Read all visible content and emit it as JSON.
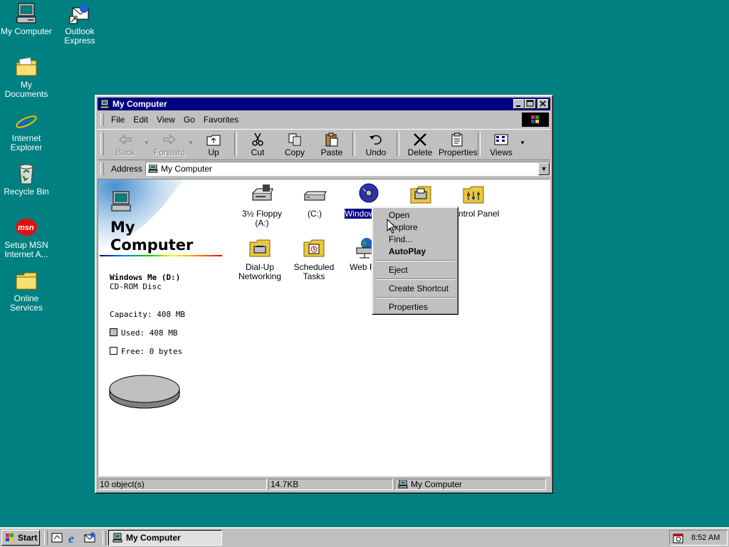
{
  "desktop": {
    "icons": [
      {
        "label": "My Computer"
      },
      {
        "label": "Outlook Express"
      },
      {
        "label": "My Documents"
      },
      {
        "label": "Internet Explorer"
      },
      {
        "label": "Recycle Bin"
      },
      {
        "label": "Setup MSN Internet A..."
      },
      {
        "label": "Online Services"
      }
    ],
    "background_color": "#008080"
  },
  "window": {
    "title": "My Computer",
    "menu": [
      "File",
      "Edit",
      "View",
      "Go",
      "Favorites"
    ],
    "toolbar": [
      {
        "label": "Back",
        "enabled": false
      },
      {
        "label": "Forward",
        "enabled": false
      },
      {
        "label": "Up",
        "enabled": true
      },
      {
        "label": "Cut",
        "enabled": true
      },
      {
        "label": "Copy",
        "enabled": true
      },
      {
        "label": "Paste",
        "enabled": true
      },
      {
        "label": "Undo",
        "enabled": true
      },
      {
        "label": "Delete",
        "enabled": true
      },
      {
        "label": "Properties",
        "enabled": true
      },
      {
        "label": "Views",
        "enabled": true
      }
    ],
    "address": {
      "label": "Address",
      "value": "My Computer"
    },
    "info": {
      "heading_line1": "My",
      "heading_line2": "Computer",
      "drive_name": "Windows Me (D:)",
      "drive_type": "CD-ROM Disc",
      "capacity": "Capacity: 408 MB",
      "used": "Used: 408 MB",
      "free": "Free: 0 bytes"
    },
    "items": [
      {
        "label": "3½ Floppy (A:)"
      },
      {
        "label": "(C:)"
      },
      {
        "label": "Window (D:)",
        "selected": true
      },
      {
        "label": ""
      },
      {
        "label": "Control Panel"
      },
      {
        "label": "Dial-Up Networking"
      },
      {
        "label": "Scheduled Tasks"
      },
      {
        "label": "Web Fo"
      }
    ],
    "context_menu": [
      {
        "label": "Open"
      },
      {
        "label": "Explore"
      },
      {
        "label": "Find..."
      },
      {
        "label": "AutoPlay",
        "bold": true
      },
      {
        "label": "Eject"
      },
      {
        "label": "Create Shortcut"
      },
      {
        "label": "Properties"
      }
    ],
    "status": {
      "objects": "10 object(s)",
      "size": "14.7KB",
      "zone": "My Computer"
    }
  },
  "taskbar": {
    "start_label": "Start",
    "tasks": [
      {
        "label": "My Computer"
      }
    ],
    "clock": "8:52 AM"
  }
}
